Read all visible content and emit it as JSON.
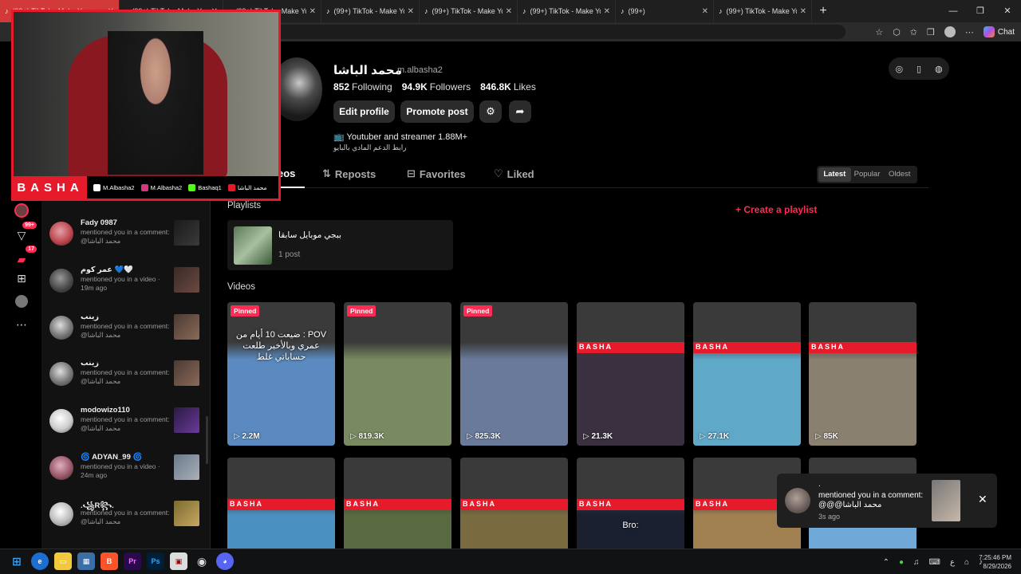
{
  "browser": {
    "tabs": [
      {
        "title": "(99+) TikTok - Make Your"
      },
      {
        "title": "(99+) TikTok - Make Your"
      },
      {
        "title": "(99+) TikTok - Make Your"
      },
      {
        "title": "(99+) TikTok - Make Your"
      },
      {
        "title": "(99+) TikTok - Make Your"
      },
      {
        "title": "(99+) TikTok - Make Your"
      },
      {
        "title": "(99+)"
      },
      {
        "title": "(99+) TikTok - Make Your"
      }
    ],
    "chat_label": "Chat"
  },
  "left_nav": {
    "badges": {
      "messages": "99+",
      "inbox": "17"
    }
  },
  "notifications": [
    {
      "name": "Fady 0987",
      "text": "mentioned you in a comment: @محمد الباشا",
      "avatar_color": "#c04850"
    },
    {
      "name": "عمر كوم 💙🤍",
      "text": "mentioned you in a video · 19m ago",
      "avatar_color": "#6a6a6a"
    },
    {
      "name": "زينب",
      "text": "mentioned you in a comment: @محمد الباشا",
      "avatar_color": "#8a8a8a"
    },
    {
      "name": "زينب",
      "text": "mentioned you in a comment: @محمد الباشا",
      "avatar_color": "#8a8a8a"
    },
    {
      "name": "modowizo110",
      "text": "mentioned you in a comment: @محمد الباشا",
      "avatar_color": "#dddddd"
    },
    {
      "name": "🌀 ADYAN_99 🌀",
      "text": "mentioned you in a video · 24m ago",
      "avatar_color": "#9a5a6a"
    },
    {
      "name": ".꧁R꧂.",
      "text": "mentioned you in a comment: @محمد الباشا",
      "avatar_color": "#cccccc"
    }
  ],
  "profile": {
    "display_name": "محمد الباشا",
    "handle": "m.albasha2",
    "following_count": "852",
    "following_label": "Following",
    "followers_count": "94.9K",
    "followers_label": "Followers",
    "likes_count": "846.8K",
    "likes_label": "Likes",
    "edit_label": "Edit profile",
    "promote_label": "Promote post",
    "bio_line1": "📺 Youtuber and streamer 1.88M+",
    "bio_line2": "رابط الدعم المادي بالبايو"
  },
  "tabs": {
    "videos": "Videos",
    "reposts": "Reposts",
    "favorites": "Favorites",
    "liked": "Liked"
  },
  "sort": {
    "latest": "Latest",
    "popular": "Popular",
    "oldest": "Oldest"
  },
  "playlists": {
    "title": "Playlists",
    "create_label": "Create a playlist",
    "items": [
      {
        "name": "ببجي موبايل سابقا",
        "count": "1 post"
      }
    ]
  },
  "videos_title": "Videos",
  "videos": [
    {
      "pinned": "Pinned",
      "views": "2.2M",
      "caption": "POV : ضيعت 10 أيام من عمري وبالأخير طلعت حساباتي غلط",
      "color": "#5a8ac0"
    },
    {
      "pinned": "Pinned",
      "views": "819.3K",
      "caption": "",
      "color": "#7a8a60"
    },
    {
      "pinned": "Pinned",
      "views": "825.3K",
      "caption": "",
      "color": "#6a7a9a"
    },
    {
      "pinned": "",
      "views": "21.3K",
      "caption": "",
      "color": "#3a3040"
    },
    {
      "pinned": "",
      "views": "27.1K",
      "caption": "",
      "color": "#60a8c8"
    },
    {
      "pinned": "",
      "views": "85K",
      "caption": "",
      "color": "#8a8070"
    },
    {
      "pinned": "",
      "views": "",
      "caption": "",
      "color": "#4a90c0"
    },
    {
      "pinned": "",
      "views": "",
      "caption": "",
      "color": "#5a6a40"
    },
    {
      "pinned": "",
      "views": "",
      "caption": "",
      "color": "#7a6a40"
    },
    {
      "pinned": "",
      "views": "",
      "caption": "Bro:",
      "color": "#1a2030"
    },
    {
      "pinned": "",
      "views": "",
      "caption": "",
      "color": "#a08050"
    },
    {
      "pinned": "",
      "views": "",
      "caption": "",
      "color": "#70a8d8"
    }
  ],
  "webcam": {
    "name": "BASHA",
    "socials": [
      "M.Albasha2",
      "M.Albasha2",
      "Bashaq1",
      "محمد الباشا"
    ]
  },
  "toast": {
    "dot": ".",
    "text": "mentioned you in a comment: @@@محمد الباشا",
    "time": "3s ago"
  },
  "taskbar": {
    "time": "7:25:46 PM",
    "date": "8/29/2026",
    "lang": "ع"
  }
}
